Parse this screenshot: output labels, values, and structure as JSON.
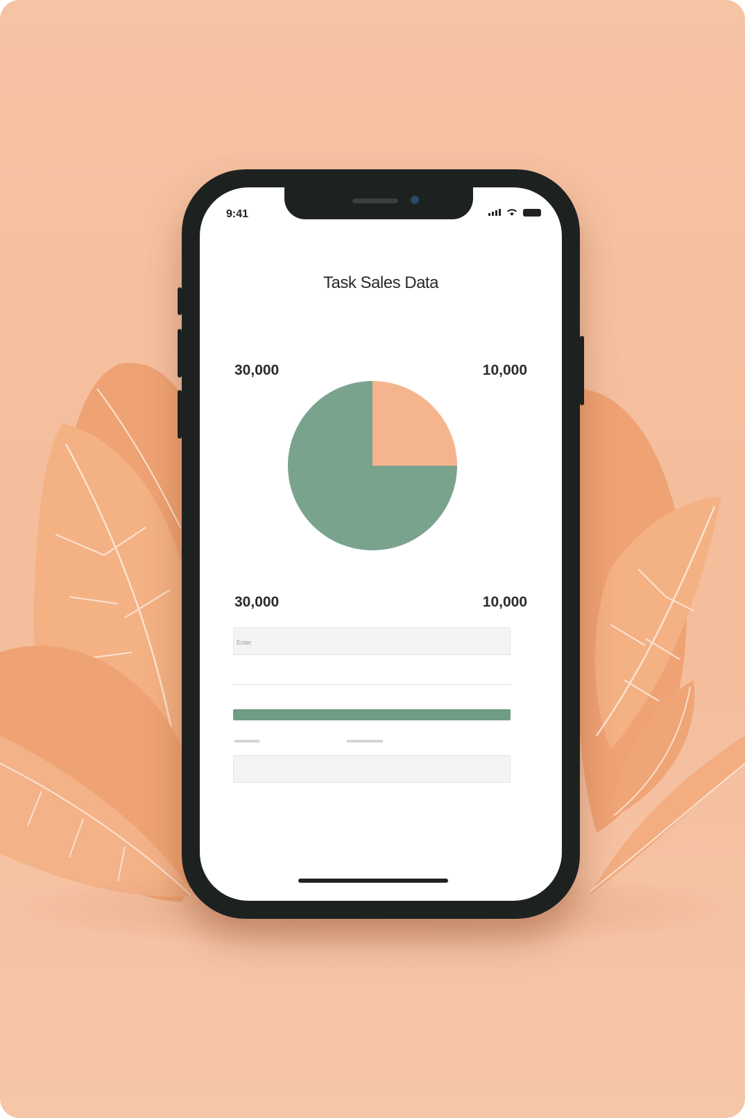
{
  "status_bar": {
    "time": "9:41"
  },
  "screen": {
    "title": "Task Sales Data",
    "labels": {
      "top_left": "30,000",
      "top_right": "10,000",
      "mid_left": "30,000",
      "mid_right": "10,000"
    },
    "input_placeholder": "Enter"
  },
  "progress": {
    "fraction": 1.0
  },
  "colors": {
    "accent_green": "#7aa38e",
    "accent_peach": "#f4b58e",
    "background": "#f6c3a4"
  },
  "chart_data": {
    "type": "pie",
    "slices": [
      {
        "value": 75,
        "color": "#7aa38e"
      },
      {
        "value": 25,
        "color": "#f4b58e"
      }
    ]
  }
}
